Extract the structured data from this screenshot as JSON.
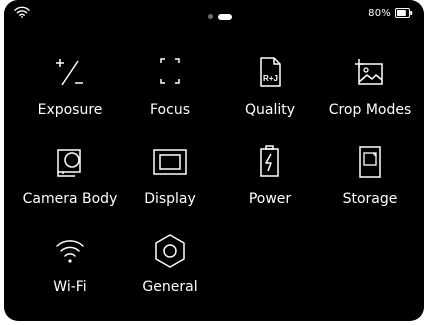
{
  "status_bar": {
    "wifi_icon": "wifi-icon",
    "page_indicator": {
      "total": 2,
      "active": 2
    },
    "battery_text": "80%",
    "battery_level": 0.8,
    "battery_icon": "battery-icon"
  },
  "menu": {
    "items": [
      {
        "label": "Exposure",
        "icon": "exposure-compensation-icon"
      },
      {
        "label": "Focus",
        "icon": "focus-frame-icon"
      },
      {
        "label": "Quality",
        "icon": "raw-jpeg-file-icon"
      },
      {
        "label": "Crop Modes",
        "icon": "crop-image-icon"
      },
      {
        "label": "Camera Body",
        "icon": "camera-body-icon"
      },
      {
        "label": "Display",
        "icon": "display-icon"
      },
      {
        "label": "Power",
        "icon": "battery-power-icon"
      },
      {
        "label": "Storage",
        "icon": "memory-card-icon"
      },
      {
        "label": "Wi-Fi",
        "icon": "wifi-icon"
      },
      {
        "label": "General",
        "icon": "hex-nut-icon"
      }
    ],
    "quality_icon_text": "R+J"
  },
  "colors": {
    "background": "#000000",
    "foreground": "#ffffff",
    "inactive_dot": "#6b6b6b"
  }
}
